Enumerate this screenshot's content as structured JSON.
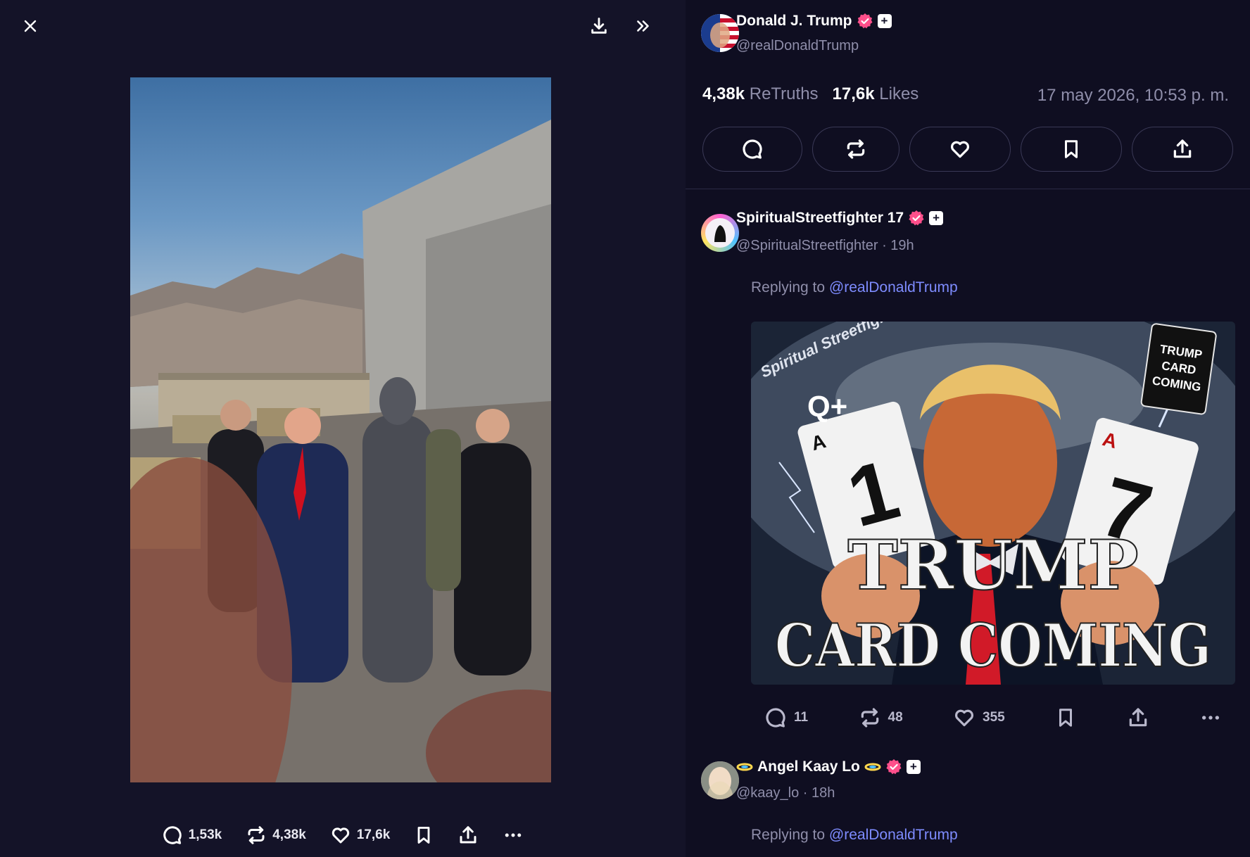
{
  "viewer": {
    "top_icons": {
      "close": "close-icon",
      "download": "download-icon",
      "expand": "chevron-double-right-icon"
    },
    "media_description_alt": "AI image: Trump walking with an alien and security at an airfield",
    "stats": {
      "replies": "1,53k",
      "retruths": "4,38k",
      "likes": "17,6k"
    }
  },
  "post": {
    "author_name": "Donald J. Trump",
    "author_handle": "@realDonaldTrump",
    "retruths_count": "4,38k",
    "retruths_label": " ReTruths",
    "likes_count": "17,6k",
    "likes_label": " Likes",
    "timestamp": "17 may 2026, 10:53 p. m."
  },
  "replies": [
    {
      "name": "SpiritualStreetfighter 17",
      "handle": "@SpiritualStreetfighter",
      "time": " · 19h",
      "replying_prefix": "Replying to ",
      "replying_handle": "@realDonaldTrump",
      "image_text": {
        "logo": "Spiritual Streetfighter",
        "q": "Q+",
        "card_left_rank": "A",
        "card_left_num": "1",
        "card_right_rank": "A",
        "card_right_num": "7",
        "corner_card": "TRUMP CARD COMING",
        "headline_1": "TRUMP",
        "headline_2": "CARD COMING"
      },
      "counts": {
        "replies": "11",
        "retruths": "48",
        "likes": "355"
      }
    },
    {
      "name": "Angel Kaay Lo",
      "handle": "@kaay_lo",
      "time": " · 18h",
      "replying_prefix": "Replying to ",
      "replying_handle": "@realDonaldTrump"
    }
  ],
  "colors": {
    "background": "#15142b",
    "panel": "#0f0e21",
    "link": "#7e8cff",
    "verified": "#ff4f8b"
  }
}
